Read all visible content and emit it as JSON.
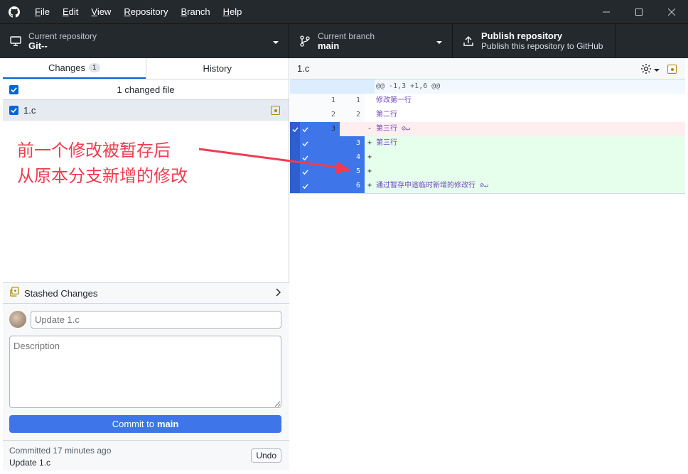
{
  "menu": {
    "items": [
      {
        "ul": "F",
        "rest": "ile"
      },
      {
        "ul": "E",
        "rest": "dit"
      },
      {
        "ul": "V",
        "rest": "iew"
      },
      {
        "ul": "R",
        "rest": "epository"
      },
      {
        "ul": "B",
        "rest": "ranch"
      },
      {
        "ul": "H",
        "rest": "elp"
      }
    ]
  },
  "toolbar": {
    "repo_label": "Current repository",
    "repo_value": "Git--",
    "branch_label": "Current branch",
    "branch_value": "main",
    "publish_title": "Publish repository",
    "publish_sub": "Publish this repository to GitHub"
  },
  "tabs": {
    "changes_label": "Changes",
    "changes_count": "1",
    "history_label": "History"
  },
  "changes": {
    "header": "1 changed file",
    "file": "1.c"
  },
  "annotation": {
    "line1": "前一个修改被暂存后",
    "line2": "从原本分支新增的修改"
  },
  "stash": {
    "label": "Stashed Changes"
  },
  "commit": {
    "summary_placeholder": "Update 1.c",
    "description_placeholder": "Description",
    "button_prefix": "Commit to",
    "button_branch": "main"
  },
  "last_commit": {
    "status": "Committed 17 minutes ago",
    "message": "Update 1.c",
    "undo_label": "Undo"
  },
  "diff": {
    "file": "1.c",
    "hunk": "@@ -1,3 +1,6 @@",
    "lines": [
      {
        "old": "1",
        "new": "1",
        "sign": "",
        "code": "修改第一行"
      },
      {
        "old": "2",
        "new": "2",
        "sign": "",
        "code": "第二行"
      },
      {
        "old": "3",
        "new": "",
        "sign": "-",
        "code": "第三行 ⊘↵"
      },
      {
        "old": "",
        "new": "3",
        "sign": "+",
        "code": "第三行"
      },
      {
        "old": "",
        "new": "4",
        "sign": "+",
        "code": ""
      },
      {
        "old": "",
        "new": "5",
        "sign": "+",
        "code": ""
      },
      {
        "old": "",
        "new": "6",
        "sign": "+",
        "code": "通过暂存中途临时新增的修改行 ⊘↵"
      }
    ]
  },
  "colors": {
    "titlebar": "#24292e",
    "accent": "#3e76ea",
    "annotation": "#f03c50"
  }
}
